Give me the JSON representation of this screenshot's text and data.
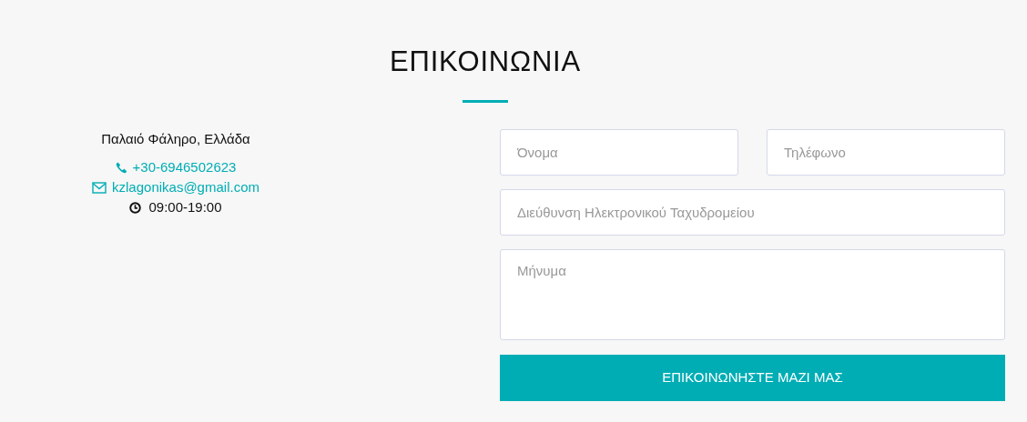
{
  "heading": "ΕΠΙΚΟΙΝΩΝΙΑ",
  "contact": {
    "address": "Παλαιό Φάληρο, Ελλάδα",
    "phone": "+30-6946502623",
    "email": "kzlagonikas@gmail.com",
    "hours": "09:00-19:00"
  },
  "form": {
    "fields": [
      {
        "kind": "input",
        "placeholder": "Όνομα"
      },
      {
        "kind": "input",
        "placeholder": "Τηλέφωνο"
      },
      {
        "kind": "input",
        "placeholder": "Διεύθυνση Ηλεκτρονικού Ταχυδρομείου"
      },
      {
        "kind": "textarea",
        "placeholder": "Μήνυμα"
      }
    ],
    "submit": "ΕΠΙΚΟΙΝΩΝΗΣΤΕ ΜΑΖΙ ΜΑΣ"
  }
}
